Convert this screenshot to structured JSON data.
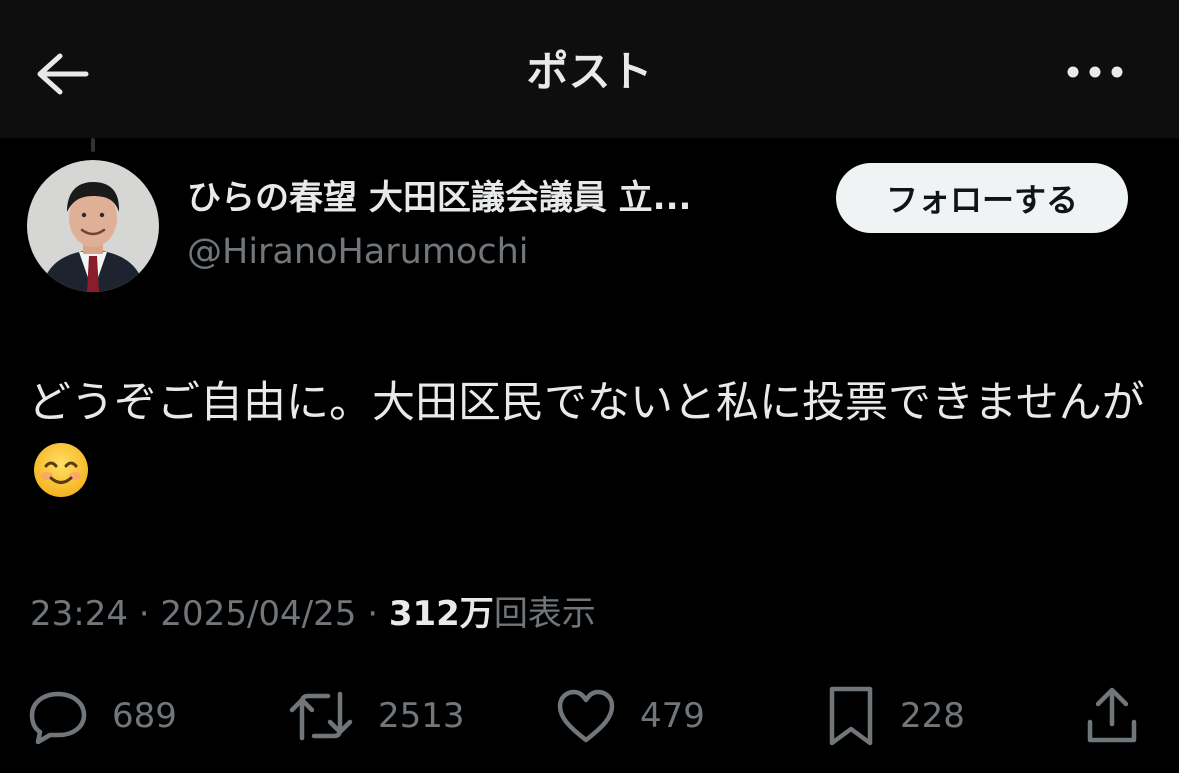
{
  "header": {
    "title": "ポスト",
    "back_icon": "arrow-left-icon",
    "more_icon": "more-horizontal-icon"
  },
  "author": {
    "display_name": "ひらの春望 大田区議会議員 立...",
    "handle": "@HiranoHarumochi",
    "follow_label": "フォローする"
  },
  "post": {
    "text": "どうぞご自由に。大田区民でないと私に投票できませんが",
    "emoji": "smiling-face-icon",
    "time": "23:24",
    "date": "2025/04/25",
    "separator": "·",
    "views_count": "312万",
    "views_label": "回表示"
  },
  "actions": {
    "reply_count": "689",
    "repost_count": "2513",
    "like_count": "479",
    "bookmark_count": "228"
  },
  "colors": {
    "background": "#000000",
    "header_background": "#0e0e0f",
    "text_primary": "#e7e9ea",
    "text_secondary": "#71767b",
    "follow_button": "#eff3f4"
  }
}
